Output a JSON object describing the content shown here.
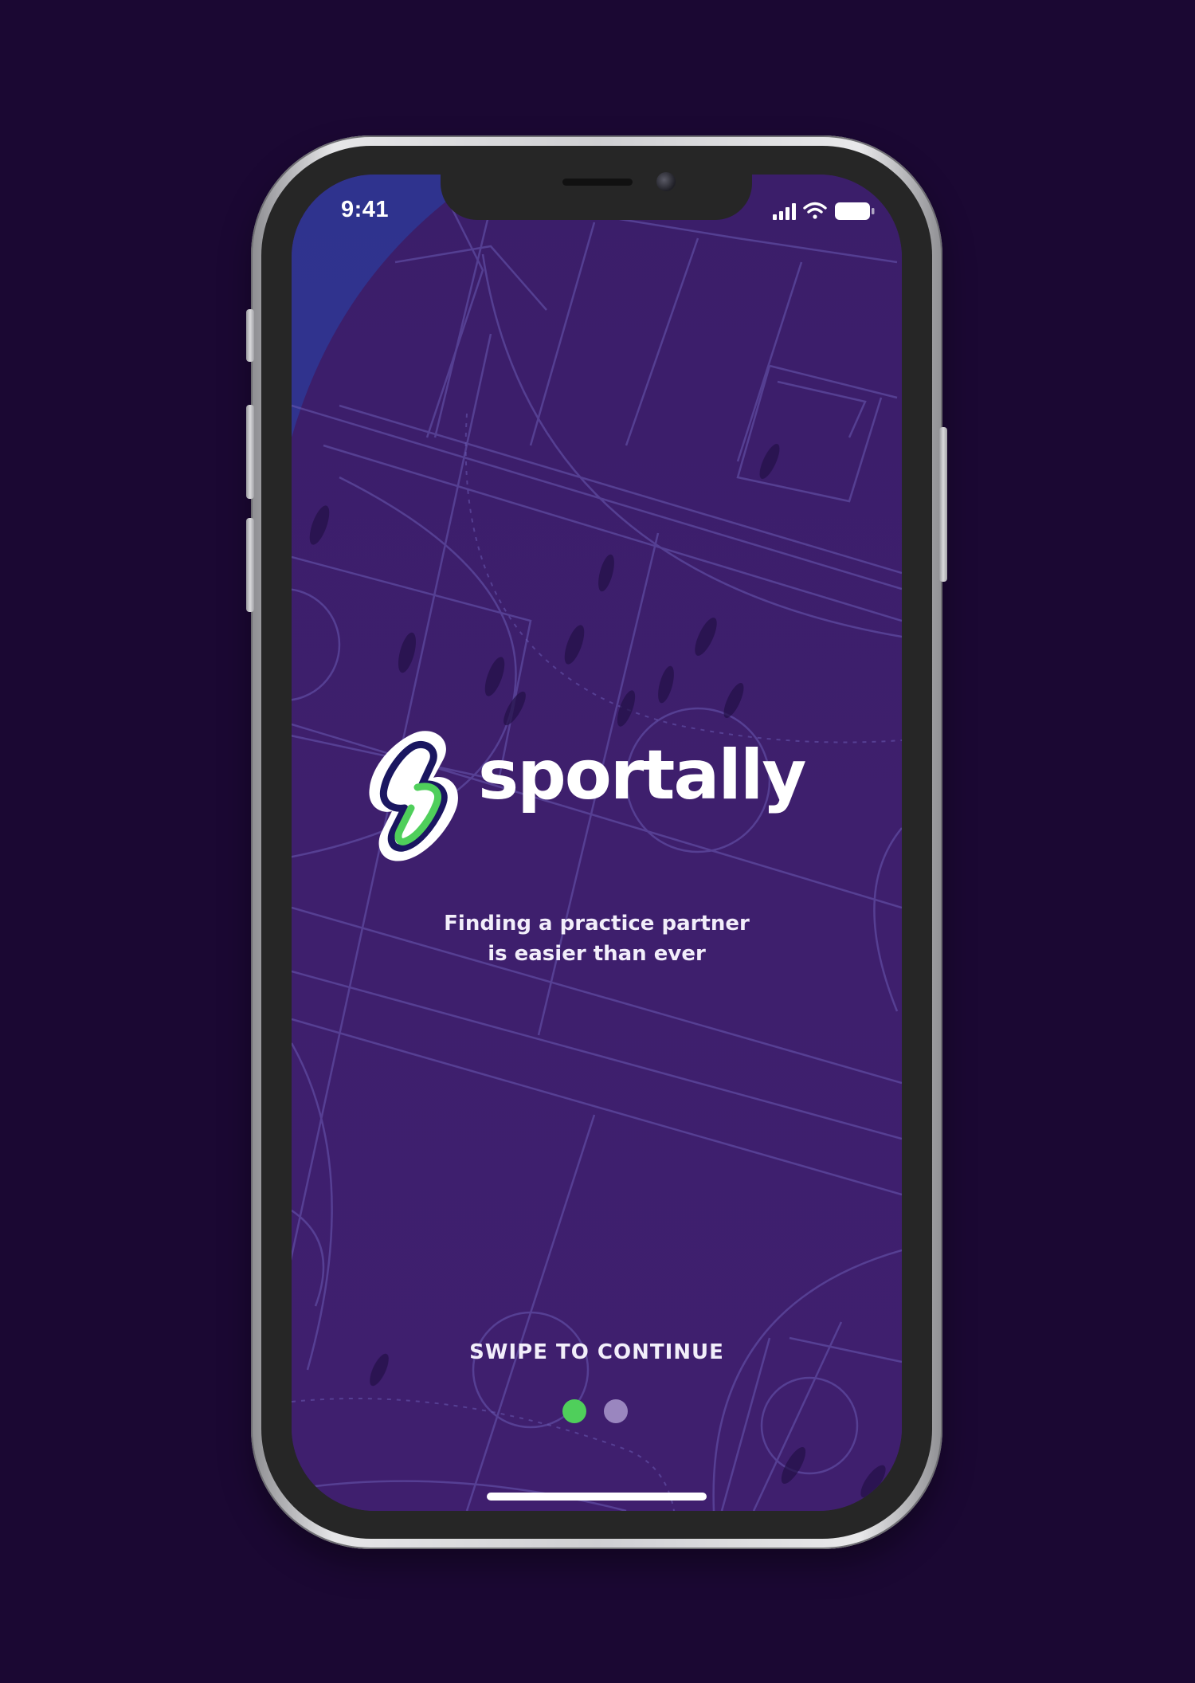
{
  "status_bar": {
    "time": "9:41",
    "icons": [
      "cellular-signal-icon",
      "wifi-icon",
      "battery-icon"
    ]
  },
  "brand": {
    "name": "sportally",
    "logo_icon": "lightning-s-logo-icon"
  },
  "tagline": {
    "line1": "Finding a practice partner",
    "line2": "is easier than ever"
  },
  "swipe_label": "SWIPE TO CONTINUE",
  "pager": {
    "total": 2,
    "current": 1
  },
  "colors": {
    "page_background": "#1b0833",
    "screen_background": "#3d1f6c",
    "court_lines": "#6a5ab3",
    "accent_green": "#4fcf5b",
    "inactive_dot": "#9a86bf",
    "logo_navy": "#1a1660",
    "text": "#ffffff"
  }
}
